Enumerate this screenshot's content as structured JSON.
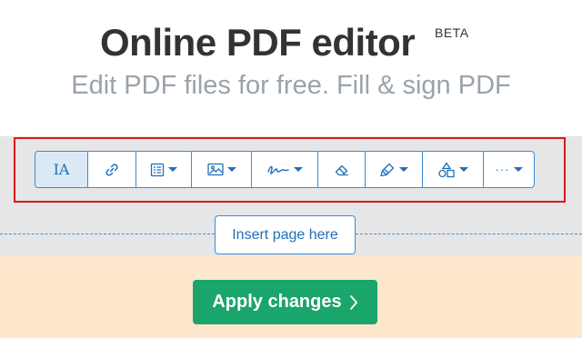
{
  "header": {
    "title": "Online PDF editor",
    "beta": "BETA",
    "subtitle": "Edit PDF files for free. Fill & sign PDF"
  },
  "toolbar": {
    "text_tool_label": "IA",
    "more_label": "···",
    "tools": [
      {
        "name": "text",
        "icon": "text-icon",
        "active": true
      },
      {
        "name": "link",
        "icon": "link-icon"
      },
      {
        "name": "forms",
        "icon": "form-icon",
        "dropdown": true
      },
      {
        "name": "image",
        "icon": "image-icon",
        "dropdown": true
      },
      {
        "name": "sign",
        "icon": "signature-icon",
        "dropdown": true
      },
      {
        "name": "whiteout",
        "icon": "eraser-icon"
      },
      {
        "name": "annotate",
        "icon": "highlighter-icon",
        "dropdown": true
      },
      {
        "name": "shapes",
        "icon": "shapes-icon",
        "dropdown": true
      },
      {
        "name": "more",
        "icon": "more-icon",
        "dropdown": true
      }
    ]
  },
  "insert_page_label": "Insert page here",
  "apply_label": "Apply changes",
  "colors": {
    "accent_blue": "#1f6fb8",
    "apply_green": "#1aa56a",
    "highlight_red": "#d71920",
    "band_gray": "#e6e6e6",
    "footer_peach": "#fde8cd"
  }
}
